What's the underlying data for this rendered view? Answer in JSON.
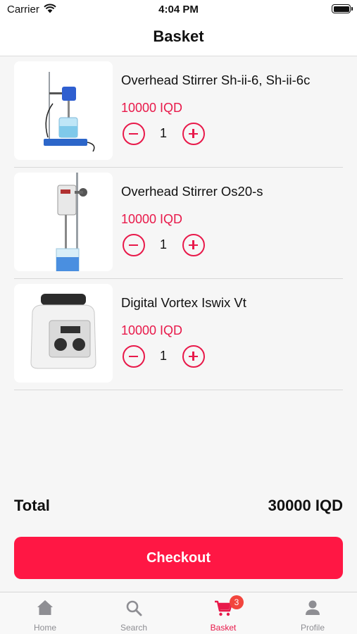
{
  "status_bar": {
    "carrier": "Carrier",
    "time": "4:04 PM"
  },
  "header": {
    "title": "Basket"
  },
  "items": [
    {
      "name": "Overhead Stirrer Sh-ii-6, Sh-ii-6c",
      "price": "10000 IQD",
      "quantity": "1",
      "image": "overhead-stirrer-sh-ii-6"
    },
    {
      "name": "Overhead Stirrer Os20-s",
      "price": "10000 IQD",
      "quantity": "1",
      "image": "overhead-stirrer-os20-s"
    },
    {
      "name": "Digital Vortex Iswix Vt",
      "price": "10000 IQD",
      "quantity": "1",
      "image": "digital-vortex-iswix-vt"
    }
  ],
  "summary": {
    "total_label": "Total",
    "total_value": "30000 IQD"
  },
  "checkout": {
    "label": "Checkout"
  },
  "tab_bar": {
    "tabs": [
      {
        "label": "Home",
        "icon": "home-icon"
      },
      {
        "label": "Search",
        "icon": "search-icon"
      },
      {
        "label": "Basket",
        "icon": "cart-icon",
        "badge": "3",
        "active": true
      },
      {
        "label": "Profile",
        "icon": "person-icon"
      }
    ]
  },
  "colors": {
    "accent": "#e8194a",
    "button": "#ff1744",
    "badge": "#f2453d",
    "tab_inactive": "#8e8e93"
  }
}
